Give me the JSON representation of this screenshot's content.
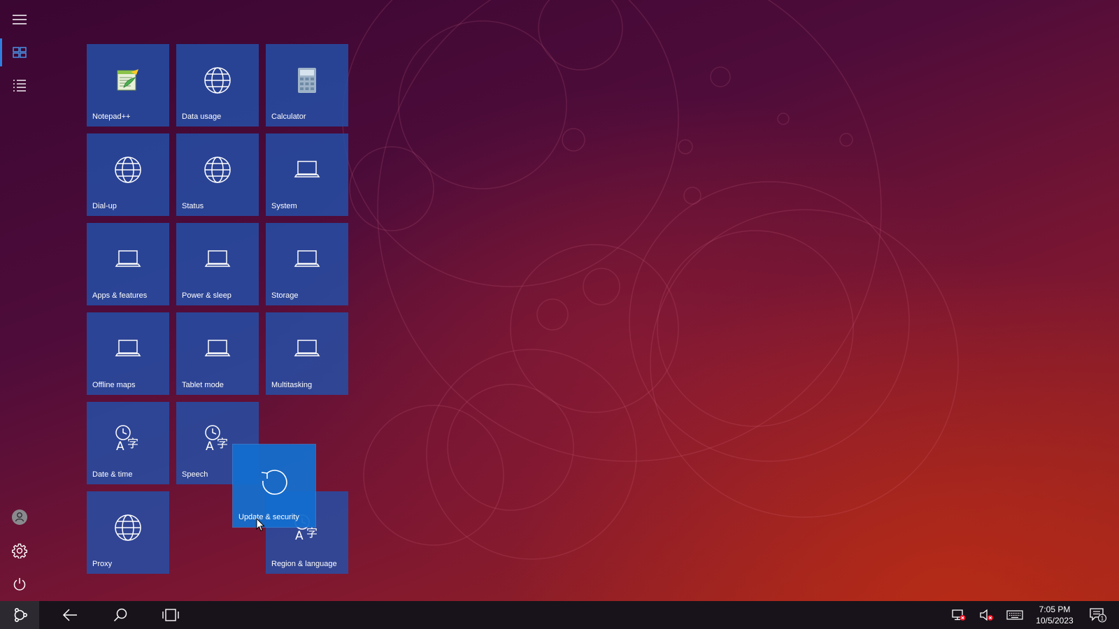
{
  "start_menu": {
    "sidebar": {
      "menu": "hamburger-icon",
      "tiles_view": "tiles-view-icon",
      "list_view": "list-view-icon",
      "user": "user-icon",
      "settings": "gear-icon",
      "power": "power-icon"
    },
    "tiles": [
      {
        "label": "Notepad++",
        "icon": "notepad-icon"
      },
      {
        "label": "Data usage",
        "icon": "globe-icon"
      },
      {
        "label": "Calculator",
        "icon": "calculator-icon"
      },
      {
        "label": "Dial-up",
        "icon": "globe-icon"
      },
      {
        "label": "Status",
        "icon": "globe-icon"
      },
      {
        "label": "System",
        "icon": "laptop-icon"
      },
      {
        "label": "Apps & features",
        "icon": "laptop-icon"
      },
      {
        "label": "Power & sleep",
        "icon": "laptop-icon"
      },
      {
        "label": "Storage",
        "icon": "laptop-icon"
      },
      {
        "label": "Offline maps",
        "icon": "laptop-icon"
      },
      {
        "label": "Tablet mode",
        "icon": "laptop-icon"
      },
      {
        "label": "Multitasking",
        "icon": "laptop-icon"
      },
      {
        "label": "Date & time",
        "icon": "time-language-icon"
      },
      {
        "label": "Speech",
        "icon": "time-language-icon"
      },
      {
        "label": "Proxy",
        "icon": "globe-icon"
      },
      {
        "label": "Region & language",
        "icon": "time-language-icon"
      }
    ],
    "dragged_tile": {
      "label": "Update & security",
      "icon": "refresh-icon"
    }
  },
  "taskbar": {
    "start": "start-icon",
    "back": "back-arrow-icon",
    "search": "search-icon",
    "task_view": "task-view-icon",
    "tray": {
      "network": "network-disconnected-icon",
      "volume": "volume-muted-icon",
      "keyboard": "keyboard-icon",
      "notifications": "notification-icon",
      "notification_count": "1"
    },
    "time": "7:05 PM",
    "date": "10/5/2023"
  },
  "colors": {
    "tile": "#2350aa",
    "tile_dragged": "#146ecd",
    "accent": "#2f7fe0",
    "taskbar": "#18131a"
  }
}
